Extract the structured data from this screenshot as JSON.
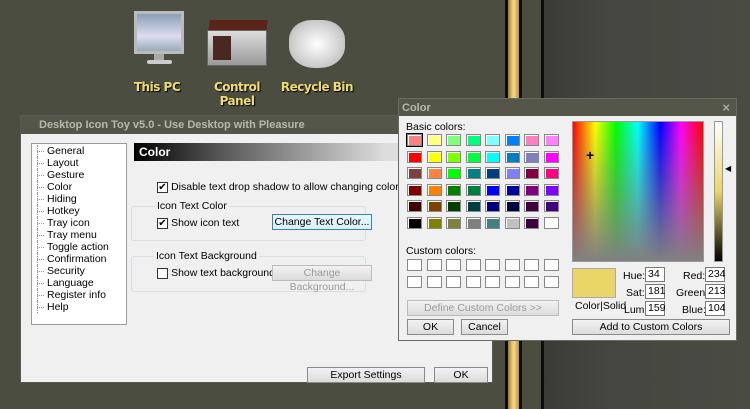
{
  "desktop": {
    "icons": [
      {
        "label": "This PC"
      },
      {
        "label": "Control Panel"
      },
      {
        "label": "Recycle Bin"
      }
    ]
  },
  "main_window": {
    "title": "Desktop Icon Toy v5.0 - Use Desktop with Pleasure",
    "nav": [
      "General",
      "Layout",
      "Gesture",
      "Color",
      "Hiding",
      "Hotkey",
      "Tray icon",
      "Tray menu",
      "Toggle action",
      "Confirmation",
      "Security",
      "Language",
      "Register info",
      "Help"
    ],
    "selected_nav": "Color",
    "section_title": "Color",
    "disable_shadow": {
      "label": "Disable text drop shadow to allow changing color",
      "checked": true
    },
    "text_color_group": {
      "title": "Icon Text Color",
      "checkbox_label": "Show icon text",
      "checked": true,
      "button": "Change Text Color..."
    },
    "text_bg_group": {
      "title": "Icon Text Background",
      "checkbox_label": "Show text background",
      "checked": false,
      "button": "Change Background..."
    },
    "export_button": "Export Settings",
    "ok_button": "OK"
  },
  "color_dialog": {
    "title": "Color",
    "close": "×",
    "basic_label": "Basic colors:",
    "basic_colors": [
      "#FF8080",
      "#FFFF80",
      "#80FF80",
      "#00FF80",
      "#80FFFF",
      "#0080FF",
      "#FF80C0",
      "#FF80FF",
      "#FF0000",
      "#FFFF00",
      "#80FF00",
      "#00FF40",
      "#00FFFF",
      "#0080C0",
      "#8080C0",
      "#FF00FF",
      "#804040",
      "#FF8040",
      "#00FF00",
      "#008080",
      "#004080",
      "#8080FF",
      "#800040",
      "#FF0080",
      "#800000",
      "#FF8000",
      "#008000",
      "#008040",
      "#0000FF",
      "#0000A0",
      "#800080",
      "#8000FF",
      "#400000",
      "#804000",
      "#004000",
      "#004040",
      "#000080",
      "#000040",
      "#400040",
      "#400080",
      "#000000",
      "#808000",
      "#808040",
      "#808080",
      "#408080",
      "#C0C0C0",
      "#400040",
      "#FFFFFF"
    ],
    "custom_label": "Custom colors:",
    "define_button": "Define Custom Colors >>",
    "ok_button": "OK",
    "cancel_button": "Cancel",
    "add_button": "Add to Custom Colors",
    "preview_label": "Color|Solid",
    "preview_color": "#EAD568",
    "hue_label": "Hue:",
    "hue": "34",
    "sat_label": "Sat:",
    "sat": "181",
    "lum_label": "Lum:",
    "lum": "159",
    "red_label": "Red:",
    "red": "234",
    "green_label": "Green:",
    "green": "213",
    "blue_label": "Blue:",
    "blue": "104"
  }
}
